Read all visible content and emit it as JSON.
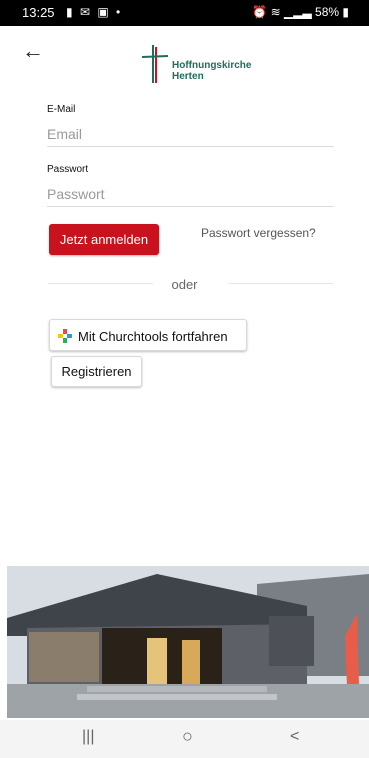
{
  "status_bar": {
    "time": "13:25",
    "left_icons": "▮ ✉ ▣ •",
    "battery": "58%"
  },
  "header": {
    "logo_line1": "Hoffnungskirche",
    "logo_line2": "Herten"
  },
  "form": {
    "email_label": "E-Mail",
    "email_placeholder": "Email",
    "password_label": "Passwort",
    "password_placeholder": "Passwort",
    "login_button": "Jetzt anmelden",
    "forgot_link": "Passwort vergessen?",
    "divider_text": "oder",
    "churchtools_button": "Mit Churchtools fortfahren",
    "register_button": "Registrieren"
  },
  "colors": {
    "accent": "#c8121d",
    "brand": "#1f6d5a"
  },
  "nav": {
    "recent": "|||",
    "home": "○",
    "back": "<"
  }
}
